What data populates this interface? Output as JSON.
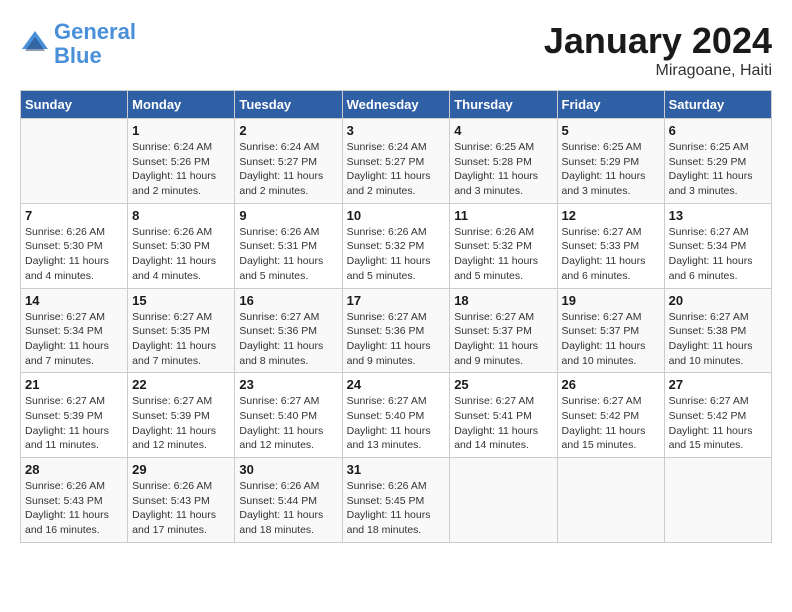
{
  "header": {
    "logo_line1": "General",
    "logo_line2": "Blue",
    "month": "January 2024",
    "location": "Miragoane, Haiti"
  },
  "weekdays": [
    "Sunday",
    "Monday",
    "Tuesday",
    "Wednesday",
    "Thursday",
    "Friday",
    "Saturday"
  ],
  "weeks": [
    [
      {
        "day": "",
        "info": ""
      },
      {
        "day": "1",
        "info": "Sunrise: 6:24 AM\nSunset: 5:26 PM\nDaylight: 11 hours and 2 minutes."
      },
      {
        "day": "2",
        "info": "Sunrise: 6:24 AM\nSunset: 5:27 PM\nDaylight: 11 hours and 2 minutes."
      },
      {
        "day": "3",
        "info": "Sunrise: 6:24 AM\nSunset: 5:27 PM\nDaylight: 11 hours and 2 minutes."
      },
      {
        "day": "4",
        "info": "Sunrise: 6:25 AM\nSunset: 5:28 PM\nDaylight: 11 hours and 3 minutes."
      },
      {
        "day": "5",
        "info": "Sunrise: 6:25 AM\nSunset: 5:29 PM\nDaylight: 11 hours and 3 minutes."
      },
      {
        "day": "6",
        "info": "Sunrise: 6:25 AM\nSunset: 5:29 PM\nDaylight: 11 hours and 3 minutes."
      }
    ],
    [
      {
        "day": "7",
        "info": "Sunrise: 6:26 AM\nSunset: 5:30 PM\nDaylight: 11 hours and 4 minutes."
      },
      {
        "day": "8",
        "info": "Sunrise: 6:26 AM\nSunset: 5:30 PM\nDaylight: 11 hours and 4 minutes."
      },
      {
        "day": "9",
        "info": "Sunrise: 6:26 AM\nSunset: 5:31 PM\nDaylight: 11 hours and 5 minutes."
      },
      {
        "day": "10",
        "info": "Sunrise: 6:26 AM\nSunset: 5:32 PM\nDaylight: 11 hours and 5 minutes."
      },
      {
        "day": "11",
        "info": "Sunrise: 6:26 AM\nSunset: 5:32 PM\nDaylight: 11 hours and 5 minutes."
      },
      {
        "day": "12",
        "info": "Sunrise: 6:27 AM\nSunset: 5:33 PM\nDaylight: 11 hours and 6 minutes."
      },
      {
        "day": "13",
        "info": "Sunrise: 6:27 AM\nSunset: 5:34 PM\nDaylight: 11 hours and 6 minutes."
      }
    ],
    [
      {
        "day": "14",
        "info": "Sunrise: 6:27 AM\nSunset: 5:34 PM\nDaylight: 11 hours and 7 minutes."
      },
      {
        "day": "15",
        "info": "Sunrise: 6:27 AM\nSunset: 5:35 PM\nDaylight: 11 hours and 7 minutes."
      },
      {
        "day": "16",
        "info": "Sunrise: 6:27 AM\nSunset: 5:36 PM\nDaylight: 11 hours and 8 minutes."
      },
      {
        "day": "17",
        "info": "Sunrise: 6:27 AM\nSunset: 5:36 PM\nDaylight: 11 hours and 9 minutes."
      },
      {
        "day": "18",
        "info": "Sunrise: 6:27 AM\nSunset: 5:37 PM\nDaylight: 11 hours and 9 minutes."
      },
      {
        "day": "19",
        "info": "Sunrise: 6:27 AM\nSunset: 5:37 PM\nDaylight: 11 hours and 10 minutes."
      },
      {
        "day": "20",
        "info": "Sunrise: 6:27 AM\nSunset: 5:38 PM\nDaylight: 11 hours and 10 minutes."
      }
    ],
    [
      {
        "day": "21",
        "info": "Sunrise: 6:27 AM\nSunset: 5:39 PM\nDaylight: 11 hours and 11 minutes."
      },
      {
        "day": "22",
        "info": "Sunrise: 6:27 AM\nSunset: 5:39 PM\nDaylight: 11 hours and 12 minutes."
      },
      {
        "day": "23",
        "info": "Sunrise: 6:27 AM\nSunset: 5:40 PM\nDaylight: 11 hours and 12 minutes."
      },
      {
        "day": "24",
        "info": "Sunrise: 6:27 AM\nSunset: 5:40 PM\nDaylight: 11 hours and 13 minutes."
      },
      {
        "day": "25",
        "info": "Sunrise: 6:27 AM\nSunset: 5:41 PM\nDaylight: 11 hours and 14 minutes."
      },
      {
        "day": "26",
        "info": "Sunrise: 6:27 AM\nSunset: 5:42 PM\nDaylight: 11 hours and 15 minutes."
      },
      {
        "day": "27",
        "info": "Sunrise: 6:27 AM\nSunset: 5:42 PM\nDaylight: 11 hours and 15 minutes."
      }
    ],
    [
      {
        "day": "28",
        "info": "Sunrise: 6:26 AM\nSunset: 5:43 PM\nDaylight: 11 hours and 16 minutes."
      },
      {
        "day": "29",
        "info": "Sunrise: 6:26 AM\nSunset: 5:43 PM\nDaylight: 11 hours and 17 minutes."
      },
      {
        "day": "30",
        "info": "Sunrise: 6:26 AM\nSunset: 5:44 PM\nDaylight: 11 hours and 18 minutes."
      },
      {
        "day": "31",
        "info": "Sunrise: 6:26 AM\nSunset: 5:45 PM\nDaylight: 11 hours and 18 minutes."
      },
      {
        "day": "",
        "info": ""
      },
      {
        "day": "",
        "info": ""
      },
      {
        "day": "",
        "info": ""
      }
    ]
  ]
}
